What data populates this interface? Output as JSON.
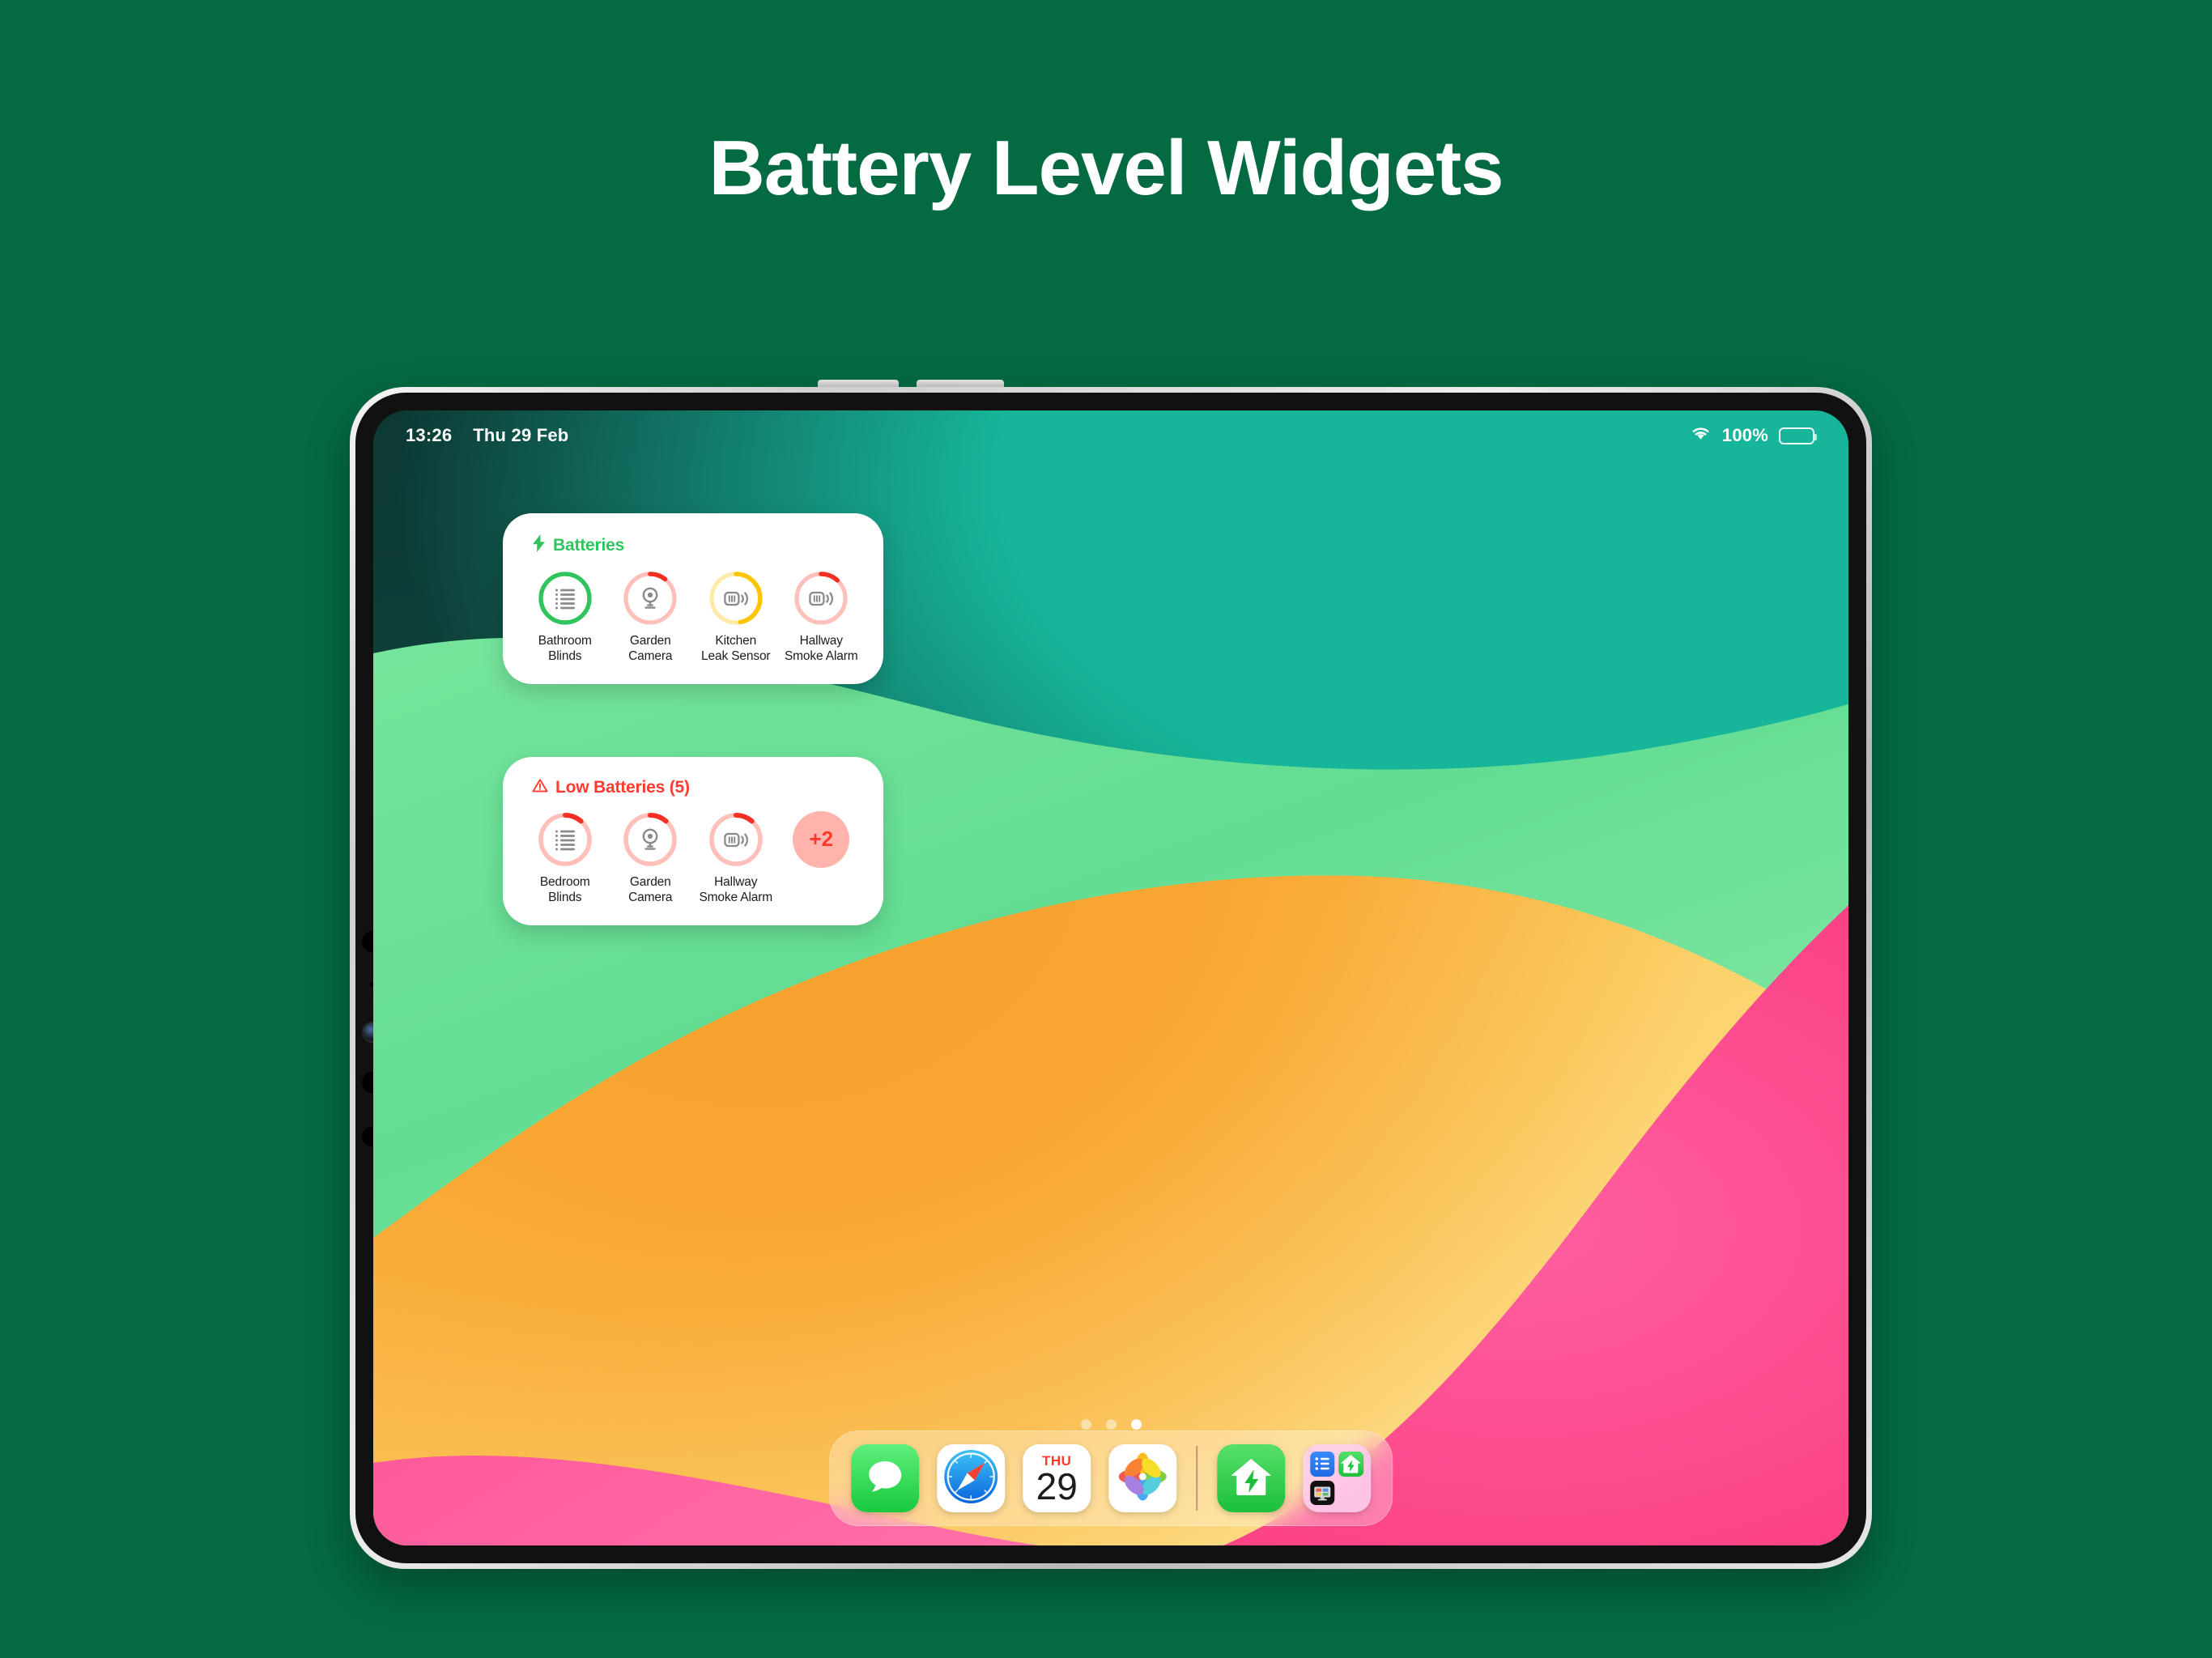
{
  "heading": "Battery Level Widgets",
  "theme": {
    "background": "#046A42",
    "accent_green": "#2fc45e",
    "accent_red": "#ff3b30",
    "accent_yellow": "#ffcc00"
  },
  "device": {
    "status_bar": {
      "time": "13:26",
      "date": "Thu 29 Feb",
      "wifi_icon": "wifi-icon",
      "battery_percent": "100%",
      "battery_icon": "battery-full-icon"
    },
    "page_dots": {
      "count": 3,
      "active_index": 2
    }
  },
  "widgets": [
    {
      "id": "batteries",
      "header_icon": "bolt-icon",
      "header_label": "Batteries",
      "header_color": "#2fc45e",
      "items": [
        {
          "label_line1": "Bathroom",
          "label_line2": "Blinds",
          "icon": "blinds-icon",
          "level": 98,
          "arc_color": "#2fc45e",
          "track_color": "#2fc45e",
          "track_style": "full"
        },
        {
          "label_line1": "Garden",
          "label_line2": "Camera",
          "icon": "camera-icon",
          "level": 11,
          "arc_color": "#f42f24",
          "track_color": "#ffc0bb",
          "track_style": "partial"
        },
        {
          "label_line1": "Kitchen",
          "label_line2": "Leak Sensor",
          "icon": "leak-sensor-icon",
          "level": 57,
          "arc_color": "#fdc400",
          "track_color": "#ffeaa8",
          "track_style": "partial"
        },
        {
          "label_line1": "Hallway",
          "label_line2": "Smoke Alarm",
          "icon": "smoke-alarm-icon",
          "level": 13,
          "arc_color": "#f42f24",
          "track_color": "#ffc0bb",
          "track_style": "partial"
        }
      ]
    },
    {
      "id": "low-batteries",
      "header_icon": "warning-triangle-icon",
      "header_label": "Low Batteries (5)",
      "header_color": "#ff3b30",
      "items": [
        {
          "label_line1": "Bedroom",
          "label_line2": "Blinds",
          "icon": "blinds-icon",
          "level": 12,
          "arc_color": "#f42f24",
          "track_color": "#ffc0bb",
          "track_style": "partial"
        },
        {
          "label_line1": "Garden",
          "label_line2": "Camera",
          "icon": "camera-icon",
          "level": 12,
          "arc_color": "#f42f24",
          "track_color": "#ffc0bb",
          "track_style": "partial"
        },
        {
          "label_line1": "Hallway",
          "label_line2": "Smoke Alarm",
          "icon": "smoke-alarm-icon",
          "level": 12,
          "arc_color": "#f42f24",
          "track_color": "#ffc0bb",
          "track_style": "partial"
        }
      ],
      "overflow_label": "+2"
    }
  ],
  "dock": {
    "apps": [
      {
        "name": "messages",
        "icon": "messages-icon"
      },
      {
        "name": "safari",
        "icon": "safari-icon"
      },
      {
        "name": "calendar",
        "icon": "calendar-icon",
        "dow": "THU",
        "day": "29"
      },
      {
        "name": "photos",
        "icon": "photos-icon"
      }
    ],
    "recents": [
      {
        "name": "home-energy",
        "icon": "home-bolt-icon"
      },
      {
        "name": "app-folder",
        "icon": "folder-icon",
        "mini_icons": [
          "list-icon",
          "home-bolt-icon",
          "display-icon"
        ]
      }
    ]
  }
}
